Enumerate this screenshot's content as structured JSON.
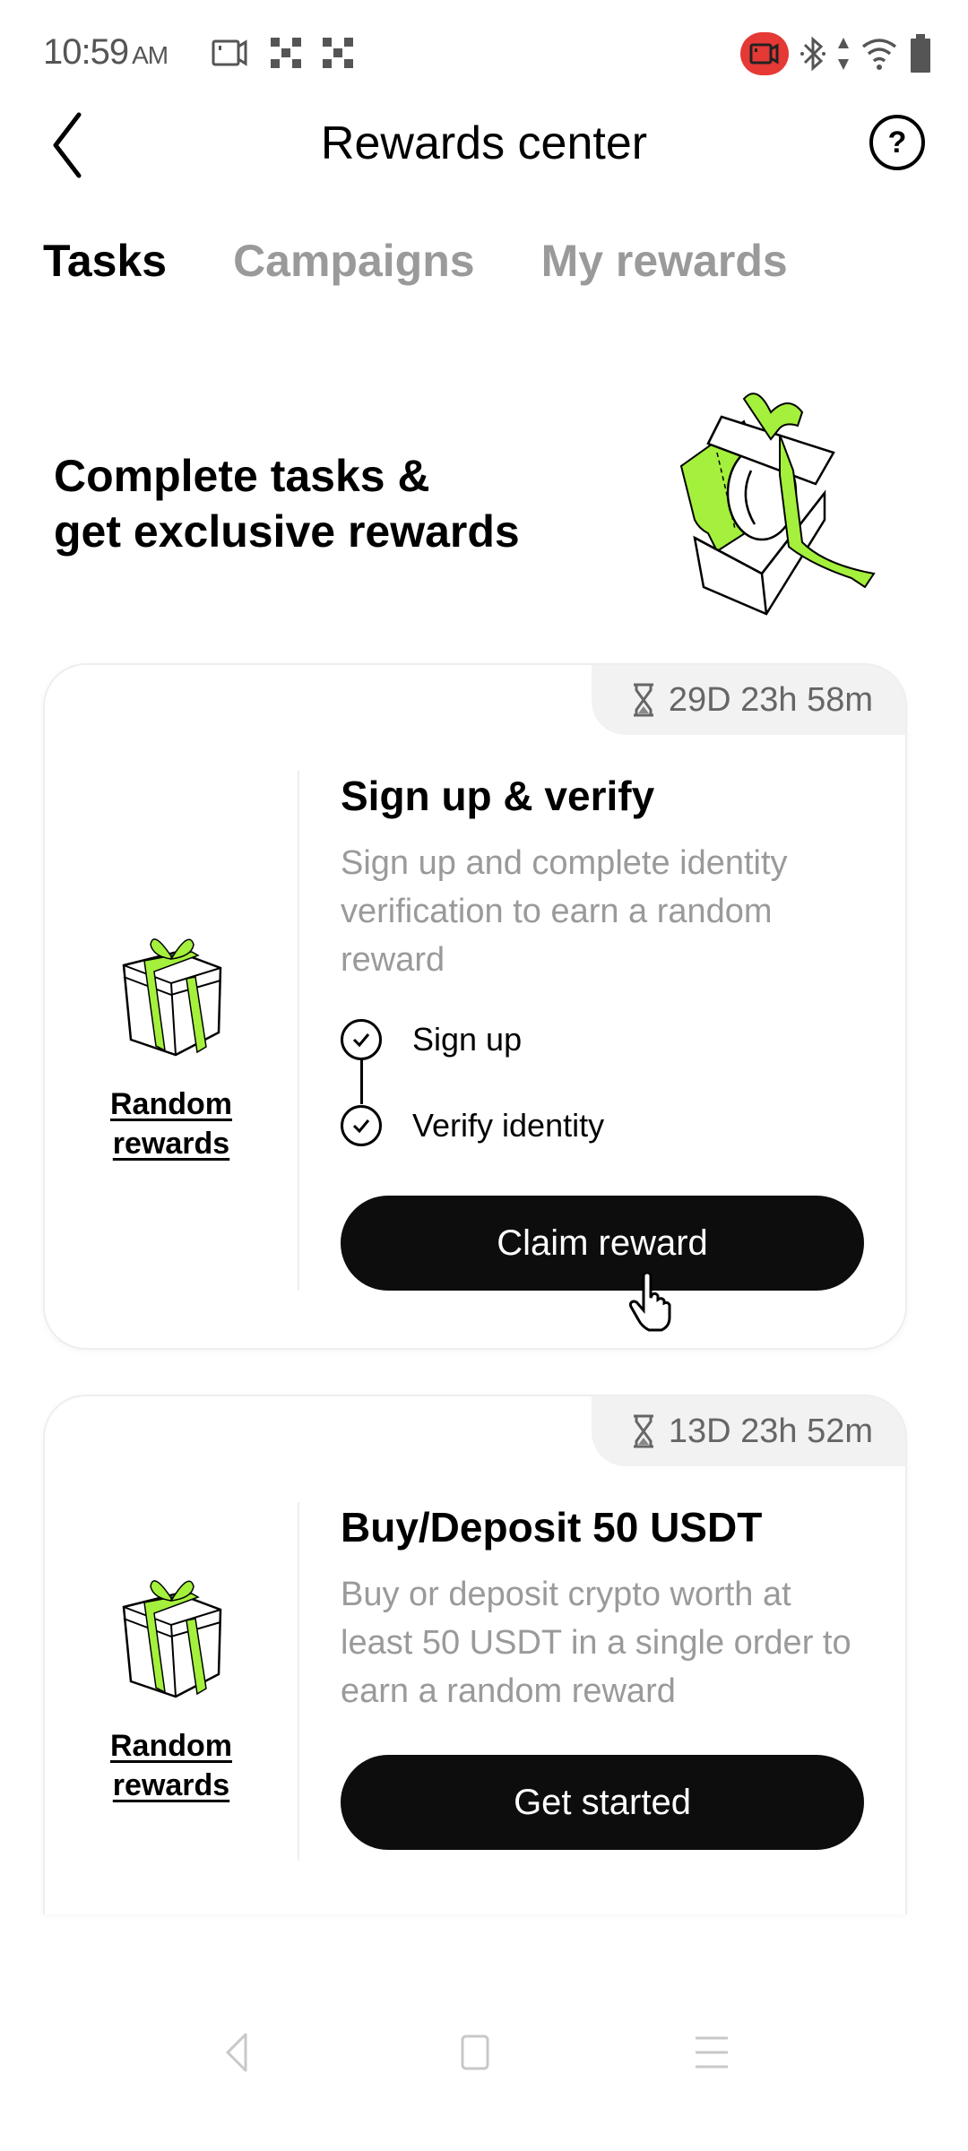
{
  "status_bar": {
    "time": "10:59",
    "ampm": "AM",
    "left_icons": [
      "screen-record-icon",
      "qr-icon",
      "qr-icon"
    ],
    "right_icons": [
      "recording-icon",
      "bluetooth-icon",
      "data-arrows-icon",
      "wifi-icon",
      "battery-icon"
    ],
    "recording_color": "#e53935"
  },
  "header": {
    "title": "Rewards center",
    "back_icon": "chevron-left-icon",
    "help_label": "?"
  },
  "tabs": [
    {
      "label": "Tasks",
      "active": true
    },
    {
      "label": "Campaigns",
      "active": false
    },
    {
      "label": "My rewards",
      "active": false
    }
  ],
  "hero": {
    "line1": "Complete tasks &",
    "line2": "get exclusive rewards",
    "accent_color": "#a4f03c"
  },
  "tasks": [
    {
      "timer": "29D 23h 58m",
      "reward_line1": "Random",
      "reward_line2": "rewards",
      "title": "Sign up & verify",
      "description": "Sign up and complete identity verification to earn a random reward",
      "steps": [
        {
          "label": "Sign up",
          "done": true
        },
        {
          "label": "Verify identity",
          "done": true
        }
      ],
      "button": "Claim reward"
    },
    {
      "timer": "13D 23h 52m",
      "reward_line1": "Random",
      "reward_line2": "rewards",
      "title": "Buy/Deposit 50 USDT",
      "description": "Buy or deposit crypto worth at least 50 USDT in a single order to earn a random reward",
      "steps": [],
      "button": "Get started"
    }
  ],
  "nav_bar": {
    "buttons": [
      "back-nav-icon",
      "home-nav-icon",
      "menu-nav-icon"
    ]
  }
}
